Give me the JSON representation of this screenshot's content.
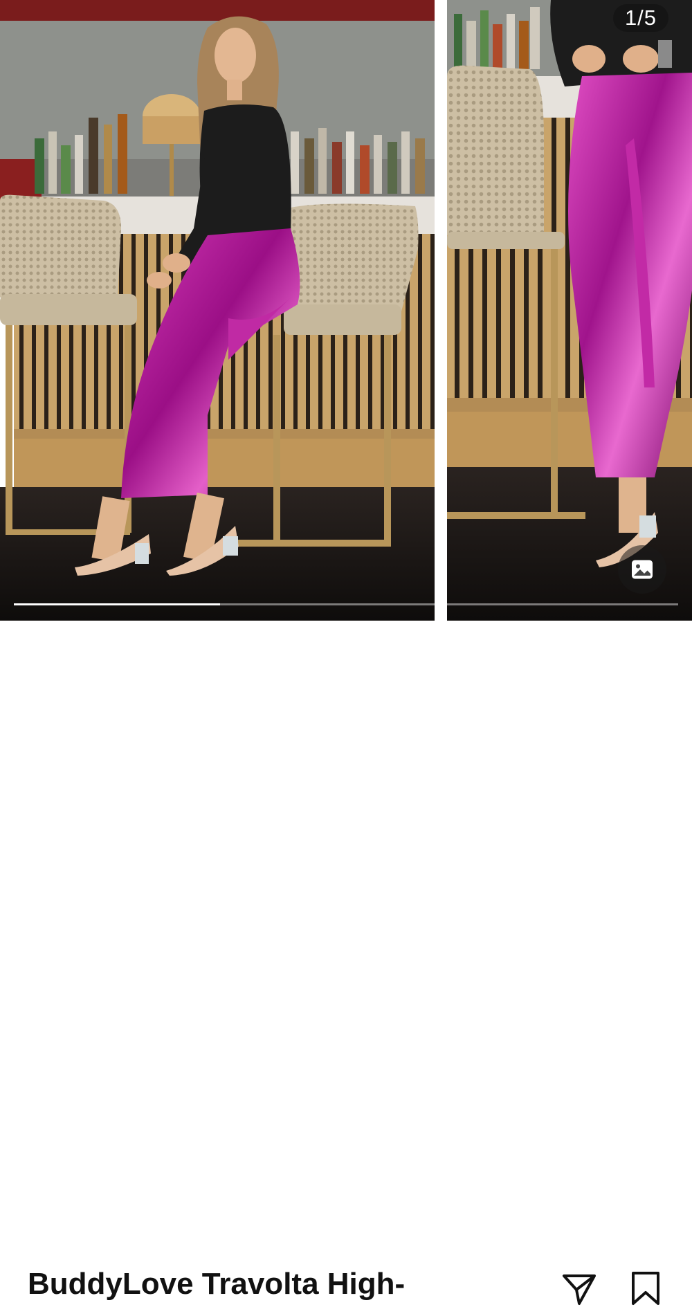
{
  "carousel": {
    "counter": "1/5",
    "current_slide": 1,
    "total_slides": 5,
    "progress_fraction": 0.31,
    "images": [
      {
        "alt": "Woman in metallic pink pants and black top sitting on a bar stool"
      },
      {
        "alt": "Close-up of metallic pink pants with clear heeled sandals"
      }
    ],
    "media_icon": "image-icon"
  },
  "product": {
    "title": "BuddyLove Travolta High-"
  },
  "actions": {
    "share_icon": "send-icon",
    "save_icon": "bookmark-icon"
  },
  "colors": {
    "accent_pants": "#b0148f",
    "text": "#111111",
    "background": "#ffffff"
  }
}
